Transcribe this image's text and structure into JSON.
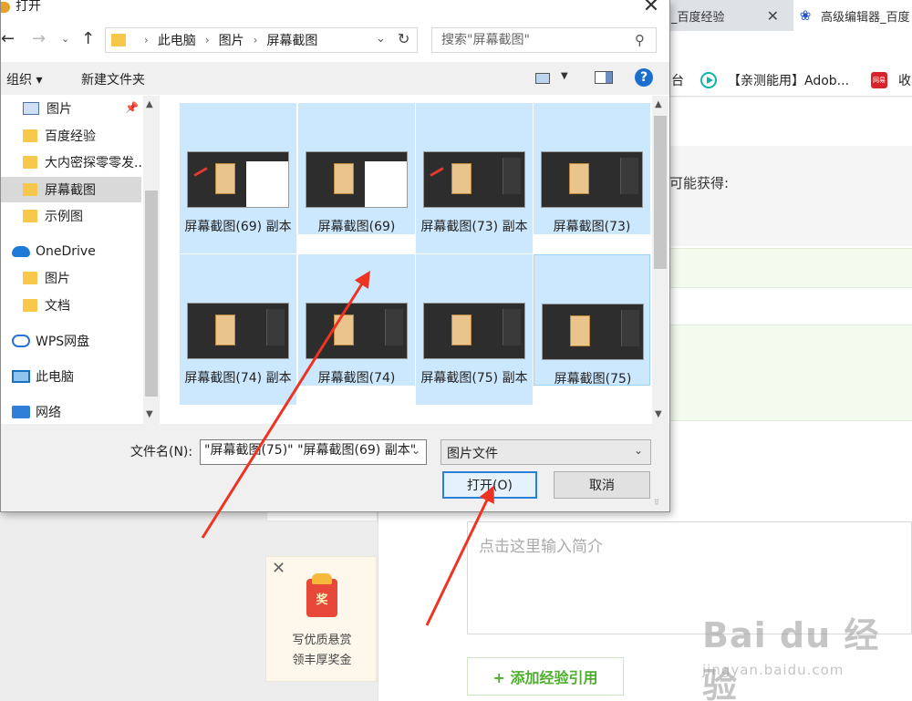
{
  "browser": {
    "tabs": [
      {
        "label": "_百度经验",
        "close": "✕"
      },
      {
        "label": "高级编辑器_百度"
      }
    ],
    "bookmarks": [
      {
        "label": "台"
      },
      {
        "label": "【亲测能用】Adob..."
      },
      {
        "label": "收"
      }
    ],
    "news_icon_text": "网易"
  },
  "page": {
    "body_text": "可能获得:",
    "summary_placeholder": "点击这里输入简介",
    "add_reference_button": "+ 添加经验引用",
    "reward": {
      "badge": "奖",
      "line1": "写优质悬赏",
      "line2": "领丰厚奖金",
      "close": "✕"
    },
    "watermark": {
      "main": "Bai du 经验",
      "sub": "jingyan.baidu.com"
    }
  },
  "dialog": {
    "title": "打开",
    "close": "✕",
    "nav": {
      "back": "←",
      "forward": "→",
      "recent": "⌄",
      "up": "↑",
      "refresh": "↻",
      "dropdown": "⌄"
    },
    "address": [
      "此电脑",
      "图片",
      "屏幕截图"
    ],
    "search_placeholder": "搜索\"屏幕截图\"",
    "organize": "组织 ▾",
    "new_folder": "新建文件夹",
    "help": "?",
    "sidebar": [
      {
        "label": "图片",
        "icon": "pictures-icon",
        "pinned": true
      },
      {
        "label": "百度经验",
        "icon": "folder-icon"
      },
      {
        "label": "大内密探零零发..",
        "icon": "folder-icon"
      },
      {
        "label": "屏幕截图",
        "icon": "folder-icon",
        "selected": true
      },
      {
        "label": "示例图",
        "icon": "folder-icon"
      },
      {
        "label": "OneDrive",
        "icon": "onedrive-icon"
      },
      {
        "label": "图片",
        "icon": "folder-icon"
      },
      {
        "label": "文档",
        "icon": "folder-icon"
      },
      {
        "label": "WPS网盘",
        "icon": "wps-cloud-icon"
      },
      {
        "label": "此电脑",
        "icon": "this-pc-icon"
      },
      {
        "label": "网络",
        "icon": "network-icon"
      }
    ],
    "files": [
      {
        "label": "屏幕截图(69) 副本",
        "selected": true
      },
      {
        "label": "屏幕截图(69)",
        "selected": true
      },
      {
        "label": "屏幕截图(73) 副本",
        "selected": true
      },
      {
        "label": "屏幕截图(73)",
        "selected": true
      },
      {
        "label": "屏幕截图(74) 副本",
        "selected": true
      },
      {
        "label": "屏幕截图(74)",
        "selected": true
      },
      {
        "label": "屏幕截图(75) 副本",
        "selected": true
      },
      {
        "label": "屏幕截图(75)",
        "selected": true
      }
    ],
    "filename_label": "文件名(N):",
    "filename_value": "\"屏幕截图(75)\" \"屏幕截图(69) 副本\"",
    "file_type": "图片文件",
    "open_button": "打开(O)",
    "cancel_button": "取消"
  },
  "colors": {
    "selection": "#cce8ff",
    "annotation_arrow": "#ee3322",
    "accent_green": "#4fae2f"
  }
}
